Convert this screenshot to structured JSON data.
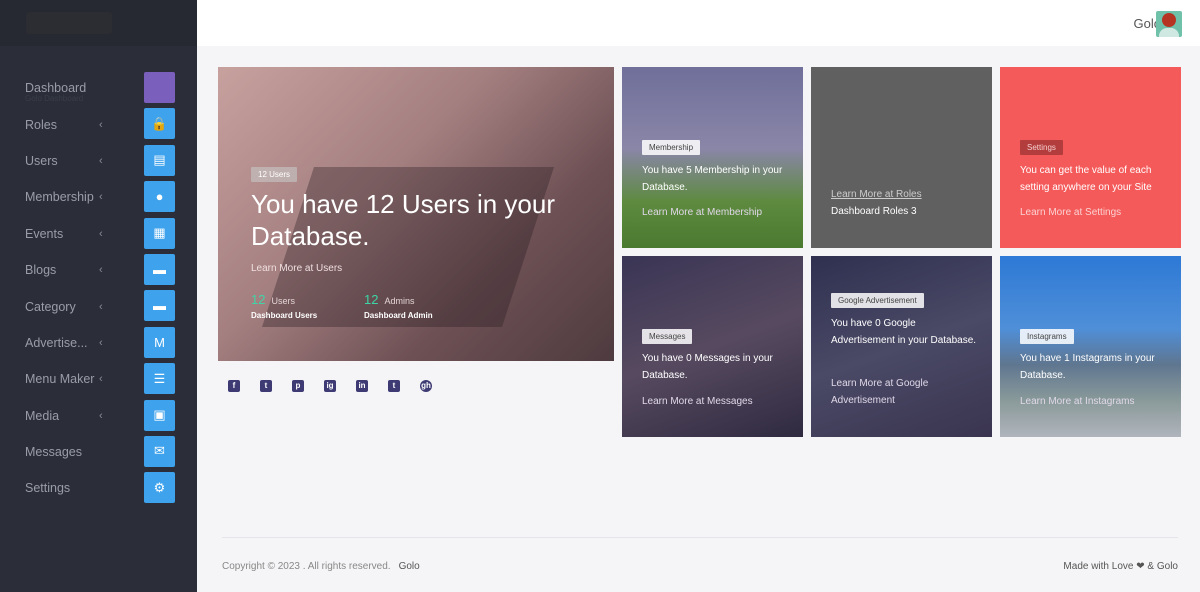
{
  "sidebar": {
    "items": [
      {
        "label": "Dashboard",
        "sub": "Golo Dashboard",
        "icon": "dashboard-icon",
        "chevron": false
      },
      {
        "label": "Roles",
        "icon": "lock-icon",
        "chevron": true
      },
      {
        "label": "Users",
        "icon": "id-card-icon",
        "chevron": true
      },
      {
        "label": "Membership",
        "icon": "fire-icon",
        "chevron": true
      },
      {
        "label": "Events",
        "icon": "calendar-icon",
        "chevron": true
      },
      {
        "label": "Blogs",
        "icon": "card-icon",
        "chevron": true
      },
      {
        "label": "Category",
        "icon": "card-icon",
        "chevron": true
      },
      {
        "label": "Advertise...",
        "icon": "medium-icon",
        "chevron": true
      },
      {
        "label": "Menu Maker",
        "icon": "bars-icon",
        "chevron": true
      },
      {
        "label": "Media",
        "icon": "photo-icon",
        "chevron": true
      },
      {
        "label": "Messages",
        "icon": "envelope-open-icon",
        "chevron": false
      },
      {
        "label": "Settings",
        "icon": "gear-icon",
        "chevron": false
      }
    ]
  },
  "topbar": {
    "user_name": "Golo"
  },
  "hero": {
    "badge": "12 Users",
    "title": "You have 12 Users in your Database.",
    "link": "Learn More at Users",
    "stats": [
      {
        "num": "12",
        "label": "Users",
        "sub": "Dashboard Users"
      },
      {
        "num": "12",
        "label": "Admins",
        "sub": "Dashboard Admin"
      }
    ]
  },
  "socials": [
    "f",
    "t",
    "p",
    "ig",
    "in",
    "t",
    "gh"
  ],
  "cards": {
    "membership": {
      "badge": "Membership",
      "text": "You have 5 Membership in your Database.",
      "link": "Learn More at Membership"
    },
    "roles": {
      "link": "Learn More at Roles",
      "text": "Dashboard Roles 3"
    },
    "settings": {
      "badge": "Settings",
      "text": "You can get the value of each setting anywhere on your Site",
      "link": "Learn More at Settings"
    },
    "messages": {
      "badge": "Messages",
      "text": "You have 0 Messages in your Database.",
      "link": "Learn More at Messages"
    },
    "google": {
      "badge": "Google Advertisement",
      "text": "You have 0 Google Advertisement in your Database.",
      "link": "Learn More at Google Advertisement"
    },
    "instagrams": {
      "badge": "Instagrams",
      "text": "You have 1 Instagrams in your Database.",
      "link": "Learn More at Instagrams"
    }
  },
  "footer": {
    "copyright": "Copyright © 2023 . All rights reserved.",
    "brand": "Golo",
    "made_with": "Made with Love",
    "made_by": "& Golo"
  },
  "colors": {
    "accent": "#3ea2ec",
    "sidebar": "#2b2e38",
    "settings_card": "#f55a5a",
    "roles_card": "#606060"
  }
}
